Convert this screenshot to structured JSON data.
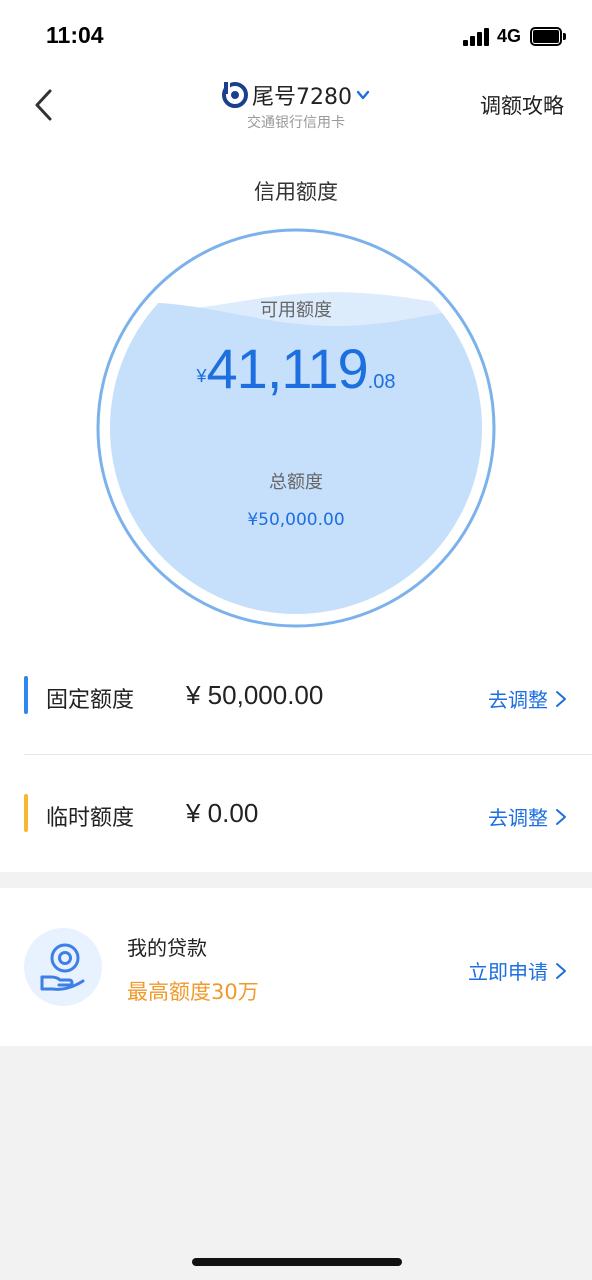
{
  "status_bar": {
    "time": "11:04",
    "network": "4G",
    "icons": [
      "signal-icon",
      "battery-icon"
    ]
  },
  "nav": {
    "card_title": "尾号7280",
    "card_subtitle": "交通银行信用卡",
    "right_action": "调额攻略",
    "icons": [
      "back-icon",
      "bank-logo-icon",
      "chevron-down-icon"
    ]
  },
  "credit": {
    "section_title": "信用额度",
    "available_label": "可用额度",
    "available_currency": "¥",
    "available_integer": "41,119",
    "available_decimal": ".08",
    "total_label": "总额度",
    "total_amount": "¥50,000.00",
    "available_fraction": 0.8224,
    "colors": {
      "accent": "#1d6fe0",
      "gauge_fill": "#c6e0fb",
      "gauge_ring": "#7bb2ec"
    }
  },
  "limits": [
    {
      "label": "固定额度",
      "value": "¥ 50,000.00",
      "action": "去调整",
      "bar_color": "#2f86ee"
    },
    {
      "label": "临时额度",
      "value": "¥ 0.00",
      "action": "去调整",
      "bar_color": "#f7b731"
    }
  ],
  "loan": {
    "title": "我的贷款",
    "subtitle": "最高额度30万",
    "action": "立即申请",
    "icon": "coin-hand-icon",
    "subtitle_color": "#f09a2c"
  }
}
